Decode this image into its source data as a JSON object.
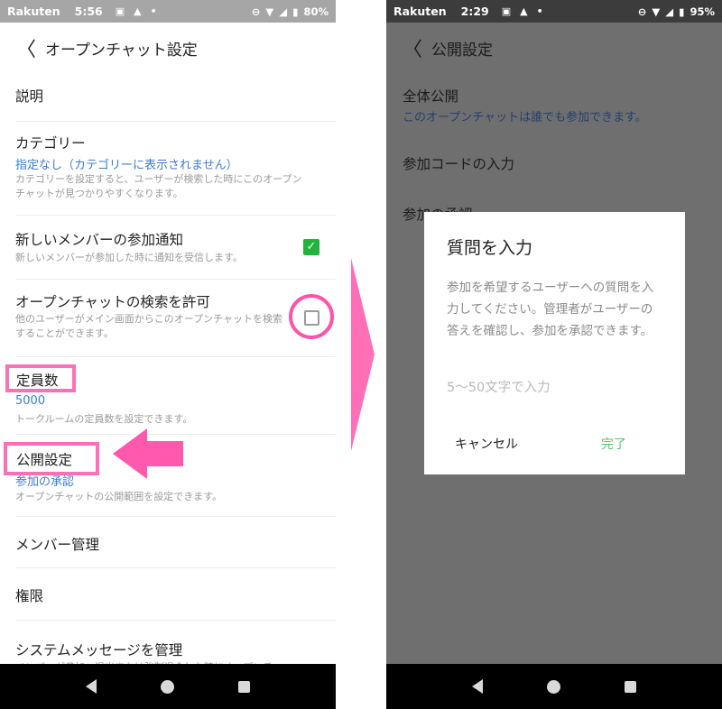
{
  "left": {
    "status": {
      "carrier": "Rakuten",
      "time": "5:56",
      "battery": "80%"
    },
    "header": {
      "title": "オープンチャット設定"
    },
    "items": [
      {
        "title": "説明"
      },
      {
        "title": "カテゴリー",
        "value": "指定なし（カテゴリーに表示されません）",
        "desc": "カテゴリーを設定すると、ユーザーが検索した時にこのオープンチャットが見つかりやすくなります。"
      },
      {
        "title": "新しいメンバーの参加通知",
        "desc": "新しいメンバーが参加した時に通知を受信します。",
        "checked": true
      },
      {
        "title": "オープンチャットの検索を許可",
        "desc": "他のユーザーがメイン画面からこのオープンチャットを検索することができます。",
        "checked": false
      },
      {
        "title": "定員数",
        "value": "5000",
        "desc": "トークルームの定員数を設定できます。"
      },
      {
        "title": "公開設定",
        "value": "参加の承認",
        "desc": "オープンチャットの公開範囲を設定できます。"
      },
      {
        "title": "メンバー管理"
      },
      {
        "title": "権限"
      },
      {
        "title": "システムメッセージを管理",
        "desc": "メンバーが参加、退出または強制退会した時にオープンチャ"
      }
    ]
  },
  "right": {
    "status": {
      "carrier": "Rakuten",
      "time": "2:29",
      "battery": "95%"
    },
    "header": {
      "title": "公開設定"
    },
    "items": [
      {
        "title": "全体公開",
        "value": "このオープンチャットは誰でも参加できます。"
      },
      {
        "title": "参加コードの入力"
      },
      {
        "title": "参加の承認"
      }
    ],
    "dialog": {
      "title": "質問を入力",
      "message": "参加を希望するユーザーへの質問を入力してください。管理者がユーザーの答えを確認し、参加を承認できます。",
      "placeholder": "5〜50文字で入力",
      "cancel": "キャンセル",
      "done": "完了"
    }
  },
  "colors": {
    "accent_pink": "#ff6fb8",
    "link_blue": "#3b7bd5",
    "check_green": "#21b33b",
    "done_green": "#4fca6a"
  }
}
